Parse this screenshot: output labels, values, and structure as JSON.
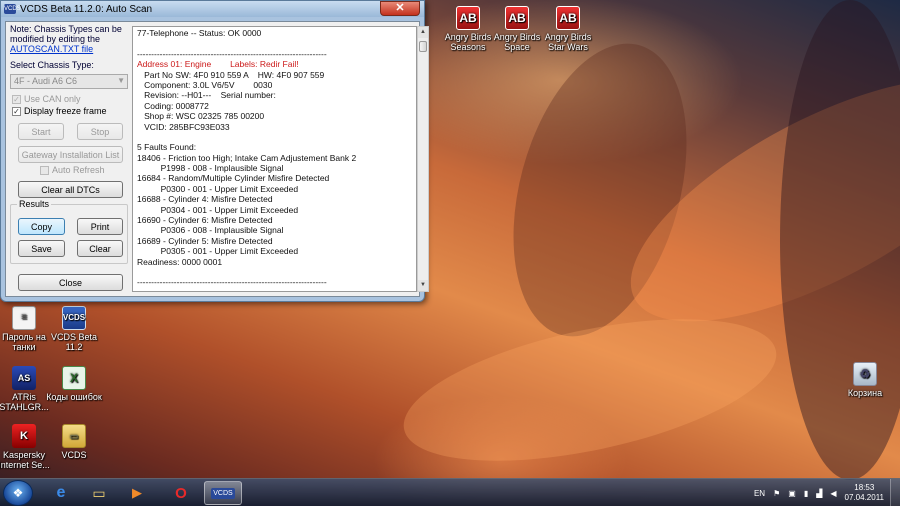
{
  "window": {
    "title": "VCDS Beta 11.2.0:  Auto Scan",
    "close_glyph": "✕",
    "app_icon_text": "VCDS",
    "note_text": "Note:  Chassis Types can be modified by editing the",
    "note_link": "AUTOSCAN.TXT file",
    "chassis_label": "Select Chassis Type:",
    "chassis_value": "4F - Audi A6 C6",
    "use_can_only": "Use CAN only",
    "display_freeze": "Display freeze frame",
    "start": "Start",
    "stop": "Stop",
    "gateway": "Gateway Installation List",
    "auto_refresh": "Auto Refresh",
    "clear_dtcs": "Clear all DTCs",
    "results_label": "Results",
    "copy": "Copy",
    "print": "Print",
    "save": "Save",
    "clear": "Clear",
    "close": "Close"
  },
  "report": {
    "lines": [
      {
        "t": "77-Telephone -- Status: OK 0000",
        "red": false
      },
      {
        "t": "",
        "red": false
      },
      {
        "t": "-------------------------------------------------------------------",
        "red": false
      },
      {
        "t": "Address 01: Engine        Labels: Redir Fail!",
        "red": true
      },
      {
        "t": "   Part No SW: 4F0 910 559 A    HW: 4F0 907 559",
        "red": false
      },
      {
        "t": "   Component: 3.0L V6/5V        0030",
        "red": false
      },
      {
        "t": "   Revision: --H01---    Serial number:",
        "red": false
      },
      {
        "t": "   Coding: 0008772",
        "red": false
      },
      {
        "t": "   Shop #: WSC 02325 785 00200",
        "red": false
      },
      {
        "t": "   VCID: 285BFC93E033",
        "red": false
      },
      {
        "t": "",
        "red": false
      },
      {
        "t": "5 Faults Found:",
        "red": false
      },
      {
        "t": "18406 - Friction too High; Intake Cam Adjustement Bank 2",
        "red": false
      },
      {
        "t": "          P1998 - 008 - Implausible Signal",
        "red": false
      },
      {
        "t": "16684 - Random/Multiple Cylinder Misfire Detected",
        "red": false
      },
      {
        "t": "          P0300 - 001 - Upper Limit Exceeded",
        "red": false
      },
      {
        "t": "16688 - Cylinder 4: Misfire Detected",
        "red": false
      },
      {
        "t": "          P0304 - 001 - Upper Limit Exceeded",
        "red": false
      },
      {
        "t": "16690 - Cylinder 6: Misfire Detected",
        "red": false
      },
      {
        "t": "          P0306 - 008 - Implausible Signal",
        "red": false
      },
      {
        "t": "16689 - Cylinder 5: Misfire Detected",
        "red": false
      },
      {
        "t": "          P0305 - 001 - Upper Limit Exceeded",
        "red": false
      },
      {
        "t": "Readiness: 0000 0001",
        "red": false
      },
      {
        "t": "",
        "red": false
      },
      {
        "t": "-------------------------------------------------------------------",
        "red": false
      }
    ]
  },
  "desktop": {
    "icons": [
      {
        "label": "Angry Birds Seasons",
        "kind": "ab",
        "glyph": "AB"
      },
      {
        "label": "Angry Birds Space",
        "kind": "ab",
        "glyph": "AB"
      },
      {
        "label": "Angry Birds Star Wars",
        "kind": "ab",
        "glyph": "AB"
      },
      {
        "label": "Пароль на танки",
        "kind": "doc",
        "glyph": "≡"
      },
      {
        "label": "VCDS Beta 11.2",
        "kind": "vcds",
        "glyph": "VCDS"
      },
      {
        "label": "ATRis STAHLGR...",
        "kind": "atr",
        "glyph": "AS"
      },
      {
        "label": "Коды ошибок",
        "kind": "xls",
        "glyph": "X"
      },
      {
        "label": "Kaspersky Internet Se...",
        "kind": "kav",
        "glyph": "K"
      },
      {
        "label": "VCDS",
        "kind": "fold",
        "glyph": "▭"
      },
      {
        "label": "Корзина",
        "kind": "bin",
        "glyph": "♻"
      }
    ]
  },
  "taskbar": {
    "start_glyph": "❖",
    "pinned": [
      {
        "name": "ie",
        "glyph": "e"
      },
      {
        "name": "explorer",
        "glyph": "▭"
      },
      {
        "name": "media-player",
        "glyph": "▶"
      },
      {
        "name": "opera",
        "glyph": "O"
      },
      {
        "name": "vcds",
        "glyph": "VCDS"
      }
    ],
    "lang": "EN",
    "time": "18:53",
    "date": "07.04.2011"
  }
}
